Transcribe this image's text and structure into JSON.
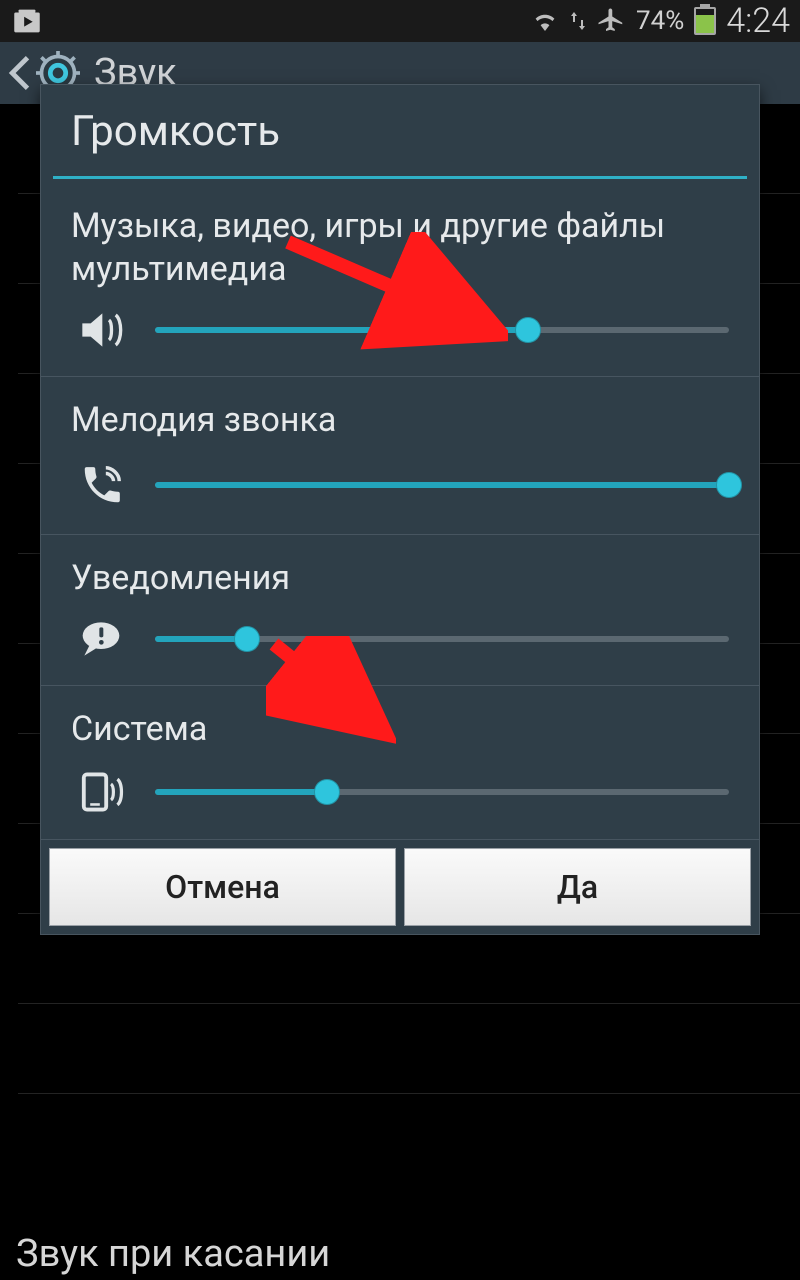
{
  "status": {
    "battery_pct_text": "74%",
    "battery_pct": 74,
    "clock": "4:24"
  },
  "actionbar": {
    "title": "Звук"
  },
  "dialog": {
    "title": "Громкость",
    "sections": [
      {
        "label": "Музыка, видео, игры и другие файлы мультимедиа",
        "icon": "speaker-icon",
        "value_pct": 65
      },
      {
        "label": "Мелодия звонка",
        "icon": "phone-ring-icon",
        "value_pct": 100
      },
      {
        "label": "Уведомления",
        "icon": "notification-bubble-icon",
        "value_pct": 16
      },
      {
        "label": "Система",
        "icon": "phone-vibrate-icon",
        "value_pct": 30
      }
    ],
    "buttons": {
      "cancel": "Отмена",
      "ok": "Да"
    }
  },
  "background": {
    "touch_sound_label": "Звук при касании"
  },
  "colors": {
    "accent": "#23a4bc",
    "dialog_bg": "#2f3e48",
    "arrow": "#ff1a1a"
  }
}
